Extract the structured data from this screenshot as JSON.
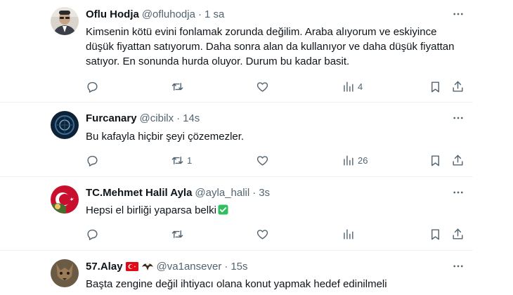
{
  "tweets": [
    {
      "name": "Oflu Hodja",
      "handle": "@ofluhodja",
      "separator": "·",
      "time": "1 sa",
      "text": "Kimsenin kötü evini fonlamak zorunda değilim. Araba alıyorum ve eskiyince düşük fiyattan satıyorum. Daha sonra alan da kullanıyor ve daha düşük fiyattan satıyor. En sonunda hurda oluyor. Durum bu kadar basit.",
      "replies": "",
      "retweets": "",
      "likes": "",
      "views": "4"
    },
    {
      "name": "Furcanary",
      "handle": "@cibilx",
      "separator": "·",
      "time": "14s",
      "text": "Bu kafayla hiçbir şeyi çözemezler.",
      "replies": "",
      "retweets": "1",
      "likes": "",
      "views": "26"
    },
    {
      "name": "TC.Mehmet Halil Ayla",
      "handle": "@ayla_halil",
      "separator": "·",
      "time": "3s",
      "text": "Hepsi el birliği yaparsa belki",
      "replies": "",
      "retweets": "",
      "likes": "",
      "views": ""
    },
    {
      "name": "57.Alay",
      "handle": "@va1ansever",
      "separator": "·",
      "time": "15s",
      "text": "Başta zengine değil ihtiyacı olana konut yapmak hedef edinilmeli",
      "replies": "",
      "retweets": "",
      "likes": "",
      "views": ""
    }
  ],
  "icons": {
    "reply": "reply-icon",
    "retweet": "retweet-icon",
    "like": "heart-icon",
    "views": "views-icon",
    "bookmark": "bookmark-icon",
    "share": "share-icon",
    "more": "more-icon",
    "check": "check-emoji-icon",
    "flag": "turkey-flag-icon",
    "eagle": "eagle-emoji-icon"
  },
  "colors": {
    "text": "#0f1419",
    "secondary": "#536471",
    "divider": "#eff3f4",
    "check_green": "#2fbf5e",
    "flag_red": "#e30a17"
  }
}
